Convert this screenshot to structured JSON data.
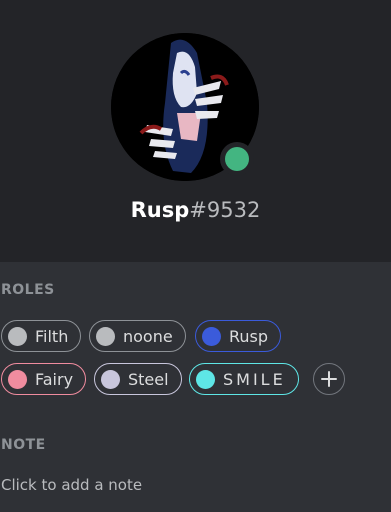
{
  "profile": {
    "name": "Rusp",
    "discriminator": "#9532",
    "status_color": "#43b581"
  },
  "roles": {
    "title": "ROLES",
    "items": [
      {
        "label": "Filth",
        "color": "#b9bbbe",
        "border": "#8e9297"
      },
      {
        "label": "noone",
        "color": "#b9bbbe",
        "border": "#8e9297"
      },
      {
        "label": "Rusp",
        "color": "#3b5bdb",
        "border": "#3b5bdb"
      },
      {
        "label": "Fairy",
        "color": "#f08c9f",
        "border": "#f08c9f"
      },
      {
        "label": "Steel",
        "color": "#c8c6dc",
        "border": "#c8c6dc"
      },
      {
        "label": "SMILE",
        "color": "#5ee6e6",
        "border": "#5ee6e6"
      }
    ],
    "add_icon": "plus-icon"
  },
  "note": {
    "title": "NOTE",
    "placeholder": "Click to add a note"
  }
}
